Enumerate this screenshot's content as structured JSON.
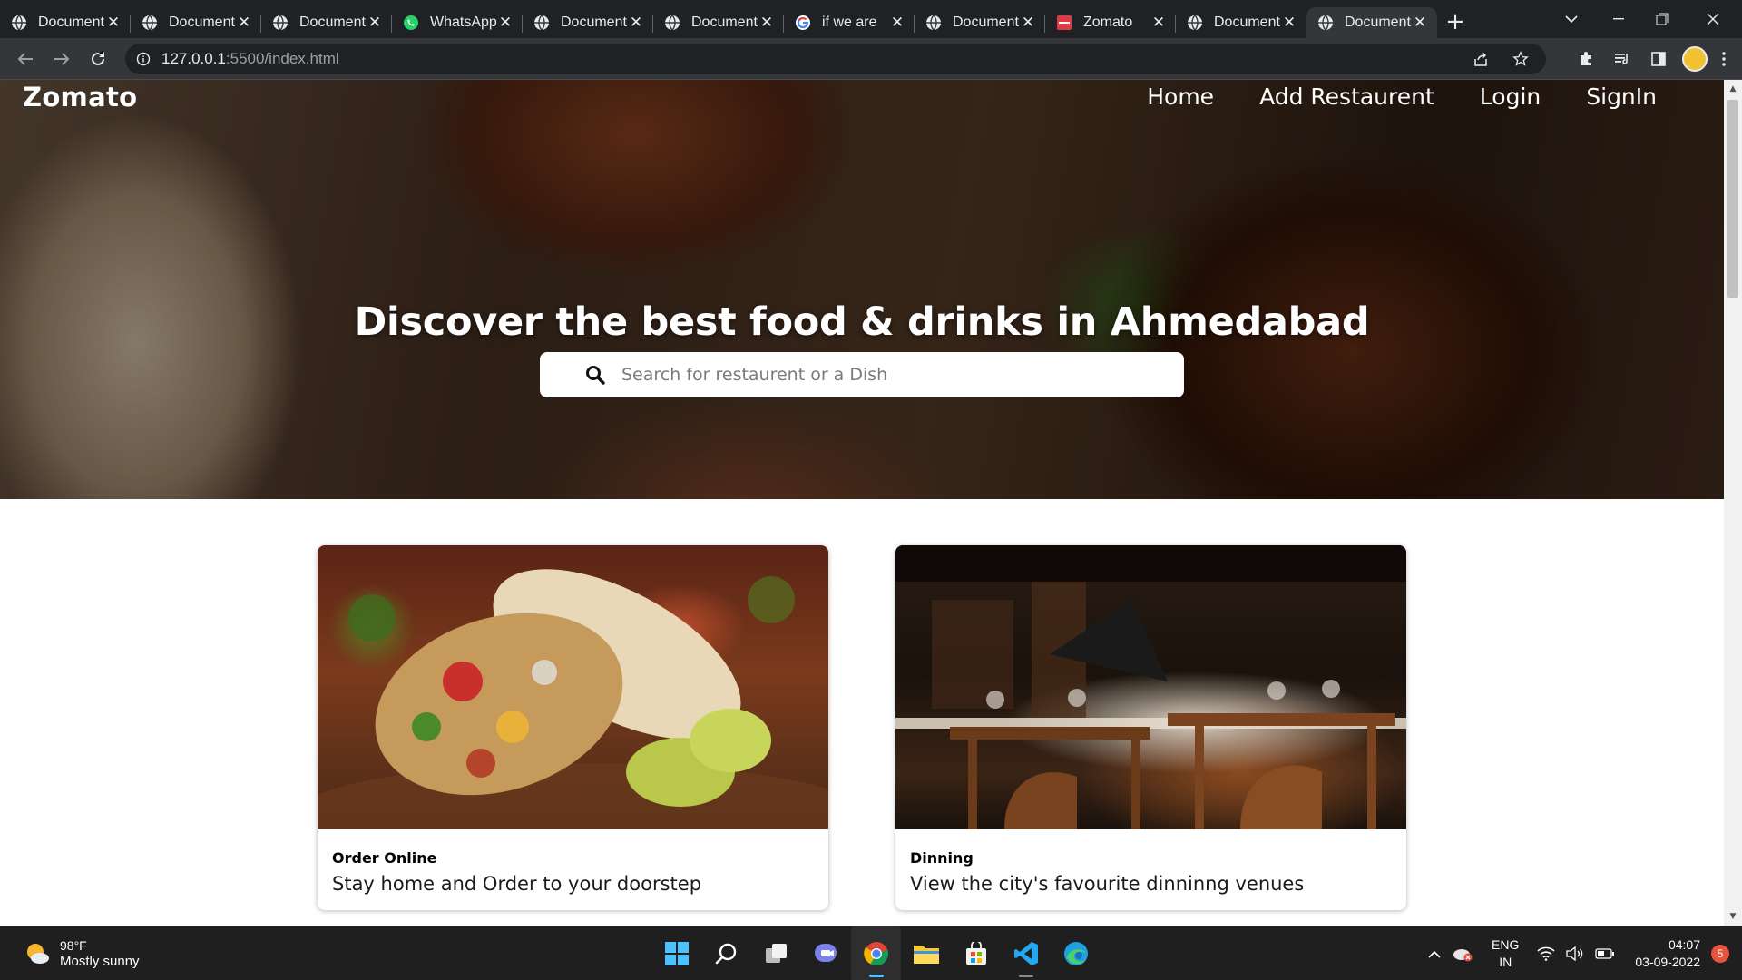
{
  "browser": {
    "tabs": [
      {
        "title": "Document",
        "icon": "globe-icon",
        "active": false
      },
      {
        "title": "Document",
        "icon": "globe-icon",
        "active": false
      },
      {
        "title": "Document",
        "icon": "globe-icon",
        "active": false
      },
      {
        "title": "WhatsApp",
        "icon": "whatsapp-icon",
        "active": false
      },
      {
        "title": "Document",
        "icon": "globe-icon",
        "active": false
      },
      {
        "title": "Document",
        "icon": "globe-icon",
        "active": false
      },
      {
        "title": "if we are",
        "icon": "google-icon",
        "active": false
      },
      {
        "title": "Document",
        "icon": "globe-icon",
        "active": false
      },
      {
        "title": "Zomato",
        "icon": "zomato-icon",
        "active": false
      },
      {
        "title": "Document",
        "icon": "globe-icon",
        "active": false
      },
      {
        "title": "Document",
        "icon": "globe-icon",
        "active": true
      }
    ],
    "url_host": "127.0.0.1",
    "url_path": ":5500/index.html"
  },
  "page": {
    "brand": "Zomato",
    "nav": [
      "Home",
      "Add Restaurent",
      "Login",
      "SignIn"
    ],
    "headline": "Discover the best food & drinks in Ahmedabad",
    "search_placeholder": "Search  for restaurent or a Dish",
    "cards": [
      {
        "title": "Order Online",
        "desc": "Stay home and Order to your doorstep"
      },
      {
        "title": "Dinning",
        "desc": "View the city's favourite dinninng venues"
      }
    ]
  },
  "taskbar": {
    "weather_temp": "98°F",
    "weather_desc": "Mostly sunny",
    "lang_1": "ENG",
    "lang_2": "IN",
    "time": "04:07",
    "date": "03-09-2022",
    "notifications": "5"
  },
  "colors": {
    "zomato_red": "#e23744",
    "whatsapp_green": "#25d366",
    "taskbar_bg": "#1f1f1f",
    "chrome_dark": "#202124"
  }
}
